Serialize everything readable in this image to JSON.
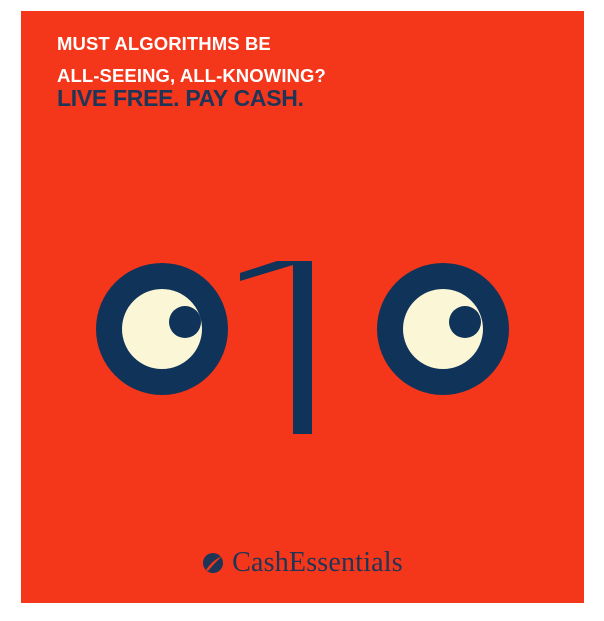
{
  "poster": {
    "headline": {
      "line1": "MUST ALGORITHMS BE",
      "line2": "ALL-SEEING, ALL-KNOWING?",
      "line3": "LIVE FREE. PAY CASH."
    },
    "emblem": {
      "glyphs": [
        "O",
        "1",
        "O"
      ],
      "icon_names": [
        "left-eye-icon",
        "one-digit-icon",
        "right-eye-icon"
      ]
    },
    "brand": {
      "name": "CashEssentials",
      "icon": "leaf-logo-icon"
    }
  },
  "colors": {
    "background": "#f4361a",
    "headline_primary": "#ffffff",
    "headline_accent": "#1e3557",
    "navy": "#10335a",
    "cream": "#fbf6d6",
    "brand_text": "#1e3557"
  }
}
